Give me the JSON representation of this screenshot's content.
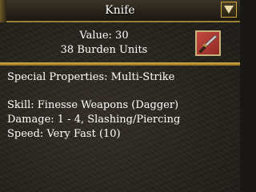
{
  "window": {
    "title": "Knife",
    "close_icon": "close-x-icon"
  },
  "item": {
    "icon": "knife-icon",
    "icon_color": "#b8392f",
    "value_text": "Value: 30",
    "burden_text": "38 Burden Units"
  },
  "details": {
    "special": "Special Properties: Multi-Strike",
    "skill": "Skill: Finesse Weapons (Dagger)",
    "damage": "Damage: 1 - 4, Slashing/Piercing",
    "speed": "Speed: Very Fast (10)"
  },
  "colors": {
    "accent": "#d9b24a",
    "text": "#ffffff",
    "background": "#2a2620"
  }
}
